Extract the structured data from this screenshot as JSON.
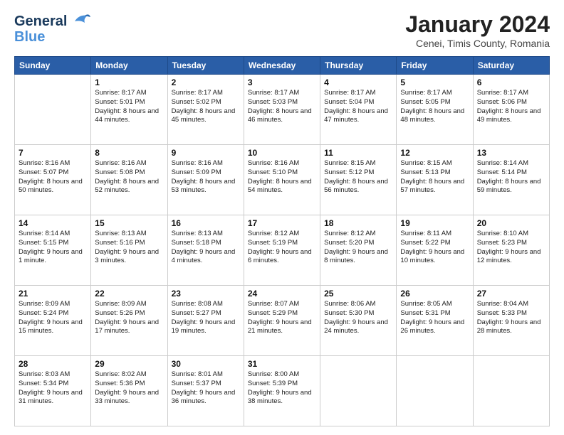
{
  "logo": {
    "line1": "General",
    "line2": "Blue"
  },
  "title": "January 2024",
  "subtitle": "Cenei, Timis County, Romania",
  "weekdays": [
    "Sunday",
    "Monday",
    "Tuesday",
    "Wednesday",
    "Thursday",
    "Friday",
    "Saturday"
  ],
  "weeks": [
    [
      {
        "day": "",
        "sunrise": "",
        "sunset": "",
        "daylight": ""
      },
      {
        "day": "1",
        "sunrise": "Sunrise: 8:17 AM",
        "sunset": "Sunset: 5:01 PM",
        "daylight": "Daylight: 8 hours and 44 minutes."
      },
      {
        "day": "2",
        "sunrise": "Sunrise: 8:17 AM",
        "sunset": "Sunset: 5:02 PM",
        "daylight": "Daylight: 8 hours and 45 minutes."
      },
      {
        "day": "3",
        "sunrise": "Sunrise: 8:17 AM",
        "sunset": "Sunset: 5:03 PM",
        "daylight": "Daylight: 8 hours and 46 minutes."
      },
      {
        "day": "4",
        "sunrise": "Sunrise: 8:17 AM",
        "sunset": "Sunset: 5:04 PM",
        "daylight": "Daylight: 8 hours and 47 minutes."
      },
      {
        "day": "5",
        "sunrise": "Sunrise: 8:17 AM",
        "sunset": "Sunset: 5:05 PM",
        "daylight": "Daylight: 8 hours and 48 minutes."
      },
      {
        "day": "6",
        "sunrise": "Sunrise: 8:17 AM",
        "sunset": "Sunset: 5:06 PM",
        "daylight": "Daylight: 8 hours and 49 minutes."
      }
    ],
    [
      {
        "day": "7",
        "sunrise": "Sunrise: 8:16 AM",
        "sunset": "Sunset: 5:07 PM",
        "daylight": "Daylight: 8 hours and 50 minutes."
      },
      {
        "day": "8",
        "sunrise": "Sunrise: 8:16 AM",
        "sunset": "Sunset: 5:08 PM",
        "daylight": "Daylight: 8 hours and 52 minutes."
      },
      {
        "day": "9",
        "sunrise": "Sunrise: 8:16 AM",
        "sunset": "Sunset: 5:09 PM",
        "daylight": "Daylight: 8 hours and 53 minutes."
      },
      {
        "day": "10",
        "sunrise": "Sunrise: 8:16 AM",
        "sunset": "Sunset: 5:10 PM",
        "daylight": "Daylight: 8 hours and 54 minutes."
      },
      {
        "day": "11",
        "sunrise": "Sunrise: 8:15 AM",
        "sunset": "Sunset: 5:12 PM",
        "daylight": "Daylight: 8 hours and 56 minutes."
      },
      {
        "day": "12",
        "sunrise": "Sunrise: 8:15 AM",
        "sunset": "Sunset: 5:13 PM",
        "daylight": "Daylight: 8 hours and 57 minutes."
      },
      {
        "day": "13",
        "sunrise": "Sunrise: 8:14 AM",
        "sunset": "Sunset: 5:14 PM",
        "daylight": "Daylight: 8 hours and 59 minutes."
      }
    ],
    [
      {
        "day": "14",
        "sunrise": "Sunrise: 8:14 AM",
        "sunset": "Sunset: 5:15 PM",
        "daylight": "Daylight: 9 hours and 1 minute."
      },
      {
        "day": "15",
        "sunrise": "Sunrise: 8:13 AM",
        "sunset": "Sunset: 5:16 PM",
        "daylight": "Daylight: 9 hours and 3 minutes."
      },
      {
        "day": "16",
        "sunrise": "Sunrise: 8:13 AM",
        "sunset": "Sunset: 5:18 PM",
        "daylight": "Daylight: 9 hours and 4 minutes."
      },
      {
        "day": "17",
        "sunrise": "Sunrise: 8:12 AM",
        "sunset": "Sunset: 5:19 PM",
        "daylight": "Daylight: 9 hours and 6 minutes."
      },
      {
        "day": "18",
        "sunrise": "Sunrise: 8:12 AM",
        "sunset": "Sunset: 5:20 PM",
        "daylight": "Daylight: 9 hours and 8 minutes."
      },
      {
        "day": "19",
        "sunrise": "Sunrise: 8:11 AM",
        "sunset": "Sunset: 5:22 PM",
        "daylight": "Daylight: 9 hours and 10 minutes."
      },
      {
        "day": "20",
        "sunrise": "Sunrise: 8:10 AM",
        "sunset": "Sunset: 5:23 PM",
        "daylight": "Daylight: 9 hours and 12 minutes."
      }
    ],
    [
      {
        "day": "21",
        "sunrise": "Sunrise: 8:09 AM",
        "sunset": "Sunset: 5:24 PM",
        "daylight": "Daylight: 9 hours and 15 minutes."
      },
      {
        "day": "22",
        "sunrise": "Sunrise: 8:09 AM",
        "sunset": "Sunset: 5:26 PM",
        "daylight": "Daylight: 9 hours and 17 minutes."
      },
      {
        "day": "23",
        "sunrise": "Sunrise: 8:08 AM",
        "sunset": "Sunset: 5:27 PM",
        "daylight": "Daylight: 9 hours and 19 minutes."
      },
      {
        "day": "24",
        "sunrise": "Sunrise: 8:07 AM",
        "sunset": "Sunset: 5:29 PM",
        "daylight": "Daylight: 9 hours and 21 minutes."
      },
      {
        "day": "25",
        "sunrise": "Sunrise: 8:06 AM",
        "sunset": "Sunset: 5:30 PM",
        "daylight": "Daylight: 9 hours and 24 minutes."
      },
      {
        "day": "26",
        "sunrise": "Sunrise: 8:05 AM",
        "sunset": "Sunset: 5:31 PM",
        "daylight": "Daylight: 9 hours and 26 minutes."
      },
      {
        "day": "27",
        "sunrise": "Sunrise: 8:04 AM",
        "sunset": "Sunset: 5:33 PM",
        "daylight": "Daylight: 9 hours and 28 minutes."
      }
    ],
    [
      {
        "day": "28",
        "sunrise": "Sunrise: 8:03 AM",
        "sunset": "Sunset: 5:34 PM",
        "daylight": "Daylight: 9 hours and 31 minutes."
      },
      {
        "day": "29",
        "sunrise": "Sunrise: 8:02 AM",
        "sunset": "Sunset: 5:36 PM",
        "daylight": "Daylight: 9 hours and 33 minutes."
      },
      {
        "day": "30",
        "sunrise": "Sunrise: 8:01 AM",
        "sunset": "Sunset: 5:37 PM",
        "daylight": "Daylight: 9 hours and 36 minutes."
      },
      {
        "day": "31",
        "sunrise": "Sunrise: 8:00 AM",
        "sunset": "Sunset: 5:39 PM",
        "daylight": "Daylight: 9 hours and 38 minutes."
      },
      {
        "day": "",
        "sunrise": "",
        "sunset": "",
        "daylight": ""
      },
      {
        "day": "",
        "sunrise": "",
        "sunset": "",
        "daylight": ""
      },
      {
        "day": "",
        "sunrise": "",
        "sunset": "",
        "daylight": ""
      }
    ]
  ]
}
